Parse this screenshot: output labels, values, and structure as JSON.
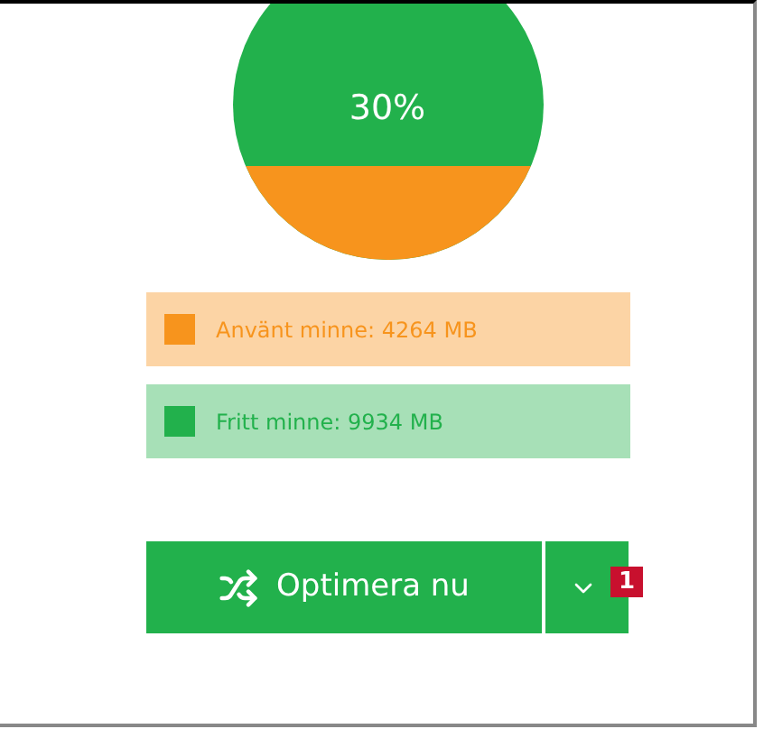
{
  "gauge": {
    "label": "30%"
  },
  "legend": [
    {
      "label": "Använt minne: 4264 MB",
      "color": "#f7941d"
    },
    {
      "label": "Fritt minne: 9934 MB",
      "color": "#22b14c"
    }
  ],
  "optimize_button": {
    "label": "Optimera nu"
  },
  "callout_badge": "1"
}
